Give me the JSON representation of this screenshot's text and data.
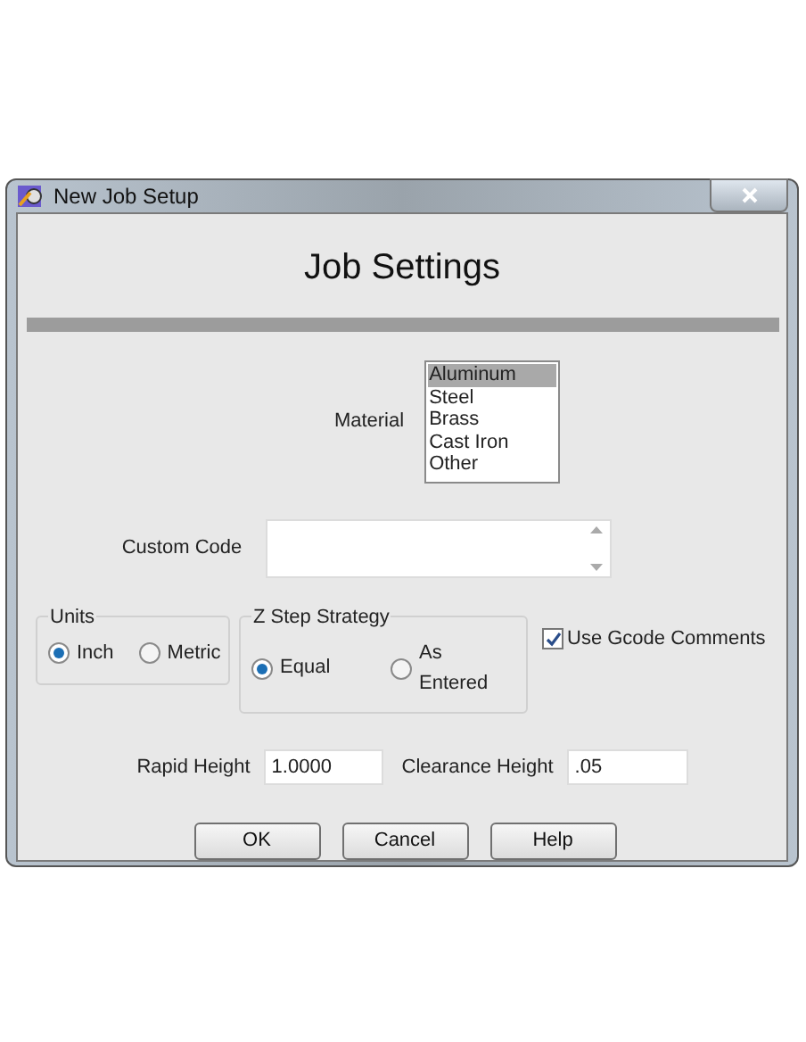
{
  "window": {
    "title": "New Job Setup"
  },
  "heading": "Job Settings",
  "material": {
    "label": "Material",
    "options": [
      {
        "label": "Aluminum",
        "selected": true
      },
      {
        "label": "Steel",
        "selected": false
      },
      {
        "label": "Brass",
        "selected": false
      },
      {
        "label": "Cast Iron",
        "selected": false
      },
      {
        "label": "Other",
        "selected": false
      }
    ]
  },
  "custom_code": {
    "label": "Custom Code"
  },
  "units": {
    "title": "Units",
    "options": [
      {
        "label": "Inch",
        "selected": true
      },
      {
        "label": "Metric",
        "selected": false
      }
    ]
  },
  "z_step_strategy": {
    "title": "Z Step Strategy",
    "options": [
      {
        "label": "Equal",
        "selected": true
      },
      {
        "label": "As Entered",
        "selected": false
      }
    ]
  },
  "use_gcode_comments": {
    "label": "Use Gcode Comments",
    "checked": true
  },
  "rapid_height": {
    "label": "Rapid Height",
    "value": "1.0000"
  },
  "clearance_height": {
    "label": "Clearance Height",
    "value": ".05"
  },
  "buttons": [
    "OK",
    "Cancel",
    "Help"
  ]
}
